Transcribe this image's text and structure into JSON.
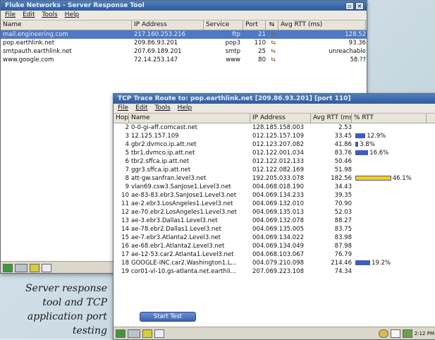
{
  "win1": {
    "title": "Fluke Networks - Server Response Tool",
    "menu": [
      "File",
      "Edit",
      "Tools",
      "Help"
    ],
    "columns": [
      "Name",
      "IP Address",
      "Service",
      "Port",
      "Avg RTT (ms)"
    ],
    "rows": [
      {
        "name": "mail.engineering.com",
        "ip": "217.160.253.216",
        "service": "ftp",
        "port": "21",
        "rtt": "128.52",
        "selected": true
      },
      {
        "name": "pop.earthlink.net",
        "ip": "209.86.93.201",
        "service": "pop3",
        "port": "110",
        "rtt": "93.36",
        "selected": false
      },
      {
        "name": "smtpauth.earthlink.net",
        "ip": "207.69.189.201",
        "service": "smtp",
        "port": "25",
        "rtt": "unreachable",
        "selected": false
      },
      {
        "name": "www.google.com",
        "ip": "72.14.253.147",
        "service": "www",
        "port": "80",
        "rtt": "58.??",
        "selected": false
      }
    ]
  },
  "win2": {
    "title": "TCP Trace Route to: pop.earthlink.net [209.86.93.201] [port 110]",
    "menu": [
      "File",
      "Edit",
      "Tools",
      "Help"
    ],
    "columns": [
      "Hop",
      "Name",
      "IP Address",
      "Avg RTT (ms)",
      "% RTT"
    ],
    "rows": [
      {
        "hop": "2",
        "name": "0-0-gi-aff.comcast.net",
        "ip": "128.185.158.003",
        "rtt": "2.53",
        "pct": ""
      },
      {
        "hop": "3",
        "name": "12.125.157.109",
        "ip": "012.125.157.109",
        "rtt": "33.45",
        "pct": "12.9%",
        "bar": 12.9,
        "color": "#3b5fc0"
      },
      {
        "hop": "4",
        "name": "gbr2.dvmco.ip.att.net",
        "ip": "012.123.207.082",
        "rtt": "41.86",
        "pct": "3.8%",
        "bar": 3.8,
        "color": "#3b5fc0"
      },
      {
        "hop": "5",
        "name": "tbr1.dvmco.ip.att.net",
        "ip": "012.122.001.034",
        "rtt": "83.76",
        "pct": "16.6%",
        "bar": 16.6,
        "color": "#3b5fc0"
      },
      {
        "hop": "6",
        "name": "tbr2.sffca.ip.att.net",
        "ip": "012.122.012.133",
        "rtt": "50.46",
        "pct": ""
      },
      {
        "hop": "7",
        "name": "ggr3.sffca.ip.att.net",
        "ip": "012.122.082.169",
        "rtt": "51.98",
        "pct": ""
      },
      {
        "hop": "8",
        "name": "att-gw.sanfran.level3.net",
        "ip": "192.205.033.078",
        "rtt": "182.56",
        "pct": "46.1%",
        "bar": 46.1,
        "color": "#f0d020"
      },
      {
        "hop": "9",
        "name": "vlan69.csw3.SanJose1.Level3.net",
        "ip": "004.068.018.190",
        "rtt": "34.43",
        "pct": ""
      },
      {
        "hop": "10",
        "name": "ae-83-83.ebr3.SanJose1.Level3.net",
        "ip": "004.069.134.233",
        "rtt": "39.35",
        "pct": ""
      },
      {
        "hop": "11",
        "name": "ae-2.ebr3.LosAngeles1.Level3.net",
        "ip": "004.069.132.010",
        "rtt": "70.90",
        "pct": ""
      },
      {
        "hop": "12",
        "name": "ae-70.ebr2.LosAngeles1.Level3.net",
        "ip": "004.069.135.013",
        "rtt": "52.03",
        "pct": ""
      },
      {
        "hop": "13",
        "name": "ae-3.ebr3.Dallas1.Level3.net",
        "ip": "004.069.132.078",
        "rtt": "88.27",
        "pct": ""
      },
      {
        "hop": "14",
        "name": "ae-78.ebr2.Dallas1.Level3.net",
        "ip": "004.069.135.005",
        "rtt": "83.75",
        "pct": ""
      },
      {
        "hop": "15",
        "name": "ae-7.ebr3.Atlanta2.Level3.net",
        "ip": "004.069.134.022",
        "rtt": "83.98",
        "pct": ""
      },
      {
        "hop": "16",
        "name": "ae-68.ebr1.Atlanta2.Level3.net",
        "ip": "004.069.134.049",
        "rtt": "87.98",
        "pct": ""
      },
      {
        "hop": "17",
        "name": "ae-12-53.car2.Atlanta1.Level3.net",
        "ip": "004.068.103.067",
        "rtt": "76.79",
        "pct": ""
      },
      {
        "hop": "18",
        "name": "GOOGLE-INC.car2.Washington1.L...",
        "ip": "004.079.210.098",
        "rtt": "214.46",
        "pct": "19.2%",
        "bar": 19.2,
        "color": "#3b5fc0"
      },
      {
        "hop": "19",
        "name": "cor01-vl-10.gs-atlanta.net.earthli...",
        "ip": "207.069.223.108",
        "rtt": "74.34",
        "pct": ""
      }
    ],
    "start_button": "Start Test"
  },
  "taskbar": {
    "clock": "2:12 PM"
  },
  "caption": [
    "Server response",
    "tool and TCP",
    "application port",
    "testing"
  ]
}
